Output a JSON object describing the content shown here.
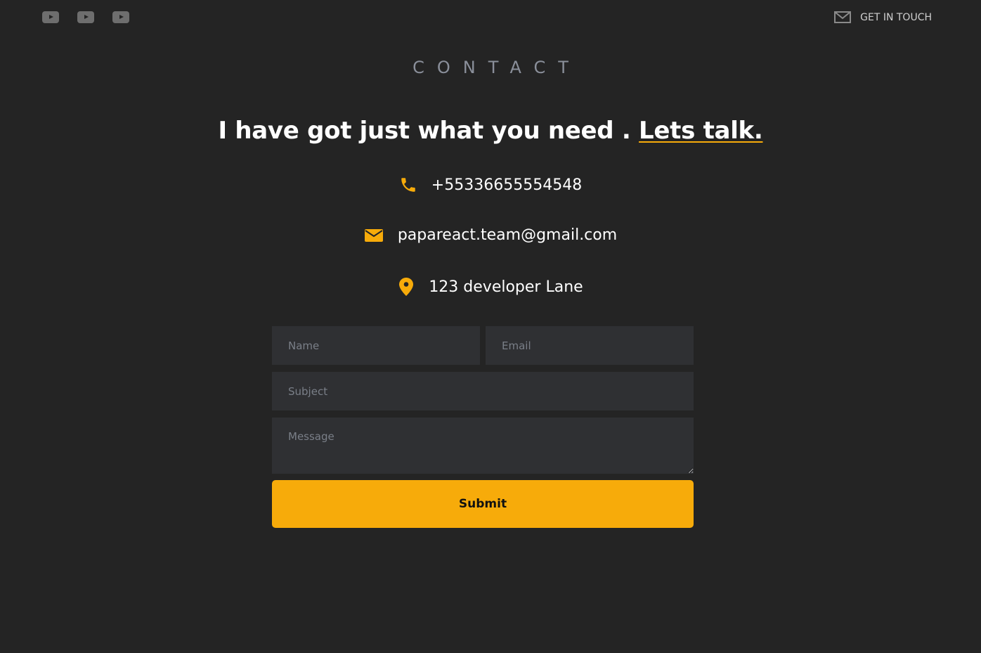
{
  "header": {
    "social_icons": [
      "youtube-icon",
      "youtube-icon",
      "youtube-icon"
    ],
    "cta_icon": "mail-icon",
    "cta_label": "GET IN TOUCH"
  },
  "section_title": "CONTACT",
  "headline": {
    "text": "I have got just what you need .",
    "accent": "Lets talk."
  },
  "contact_info": {
    "phone": "+55336655554548",
    "email": "papareact.team@gmail.com",
    "address": "123 developer Lane"
  },
  "form": {
    "name_placeholder": "Name",
    "email_placeholder": "Email",
    "subject_placeholder": "Subject",
    "message_placeholder": "Message",
    "submit_label": "Submit"
  },
  "colors": {
    "background": "#242424",
    "accent": "#f7ab0a",
    "input_background": "#2f3033"
  }
}
